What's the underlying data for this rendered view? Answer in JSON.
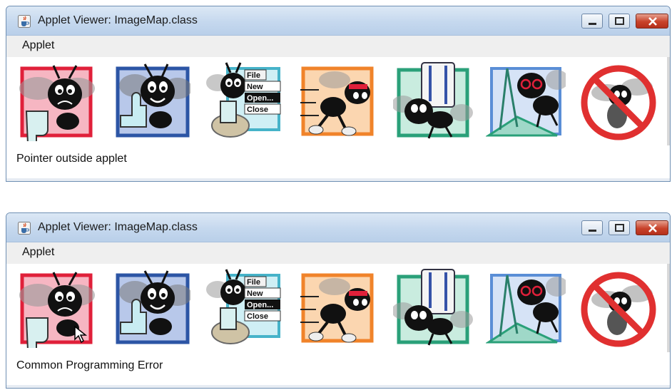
{
  "windows": [
    {
      "title": "Applet Viewer: ImageMap.class",
      "menu": {
        "applet": "Applet"
      },
      "status": "Pointer outside applet",
      "images": [
        {
          "icon": "bug-thumbs-down-icon",
          "frame": "#e0203a",
          "tint": "#f6b6c2",
          "highlight": false
        },
        {
          "icon": "bug-thumbs-up-icon",
          "frame": "#2c55a5",
          "tint": "#b8c8ea",
          "highlight": false
        },
        {
          "icon": "bug-menu-mouse-icon",
          "frame": "#46b3c9",
          "tint": "#cfeff5",
          "highlight": false
        },
        {
          "icon": "running-bug-icon",
          "frame": "#f0832a",
          "tint": "#fbd6b0",
          "highlight": false
        },
        {
          "icon": "bug-carrying-books-icon",
          "frame": "#2aa079",
          "tint": "#c9ecdf",
          "highlight": false
        },
        {
          "icon": "bug-with-compass-icon",
          "frame": "#5a8ed6",
          "tint": "#d6e3f6",
          "highlight": false
        },
        {
          "icon": "no-bugs-icon",
          "frame": "#e03030",
          "tint": "#ffffff",
          "highlight": false
        }
      ],
      "menu_picture": {
        "file": "File",
        "new": "New",
        "open": "Open...",
        "close": "Close"
      }
    },
    {
      "title": "Applet Viewer: ImageMap.class",
      "menu": {
        "applet": "Applet"
      },
      "status": "Common Programming Error",
      "images": [
        {
          "icon": "bug-thumbs-down-icon",
          "frame": "#e0203a",
          "tint": "#f6b6c2",
          "highlight": true
        },
        {
          "icon": "bug-thumbs-up-icon",
          "frame": "#2c55a5",
          "tint": "#b8c8ea",
          "highlight": false
        },
        {
          "icon": "bug-menu-mouse-icon",
          "frame": "#46b3c9",
          "tint": "#cfeff5",
          "highlight": false
        },
        {
          "icon": "running-bug-icon",
          "frame": "#f0832a",
          "tint": "#fbd6b0",
          "highlight": false
        },
        {
          "icon": "bug-carrying-books-icon",
          "frame": "#2aa079",
          "tint": "#c9ecdf",
          "highlight": false
        },
        {
          "icon": "bug-with-compass-icon",
          "frame": "#5a8ed6",
          "tint": "#d6e3f6",
          "highlight": false
        },
        {
          "icon": "no-bugs-icon",
          "frame": "#e03030",
          "tint": "#ffffff",
          "highlight": false
        }
      ],
      "menu_picture": {
        "file": "File",
        "new": "New",
        "open": "Open...",
        "close": "Close"
      }
    }
  ]
}
